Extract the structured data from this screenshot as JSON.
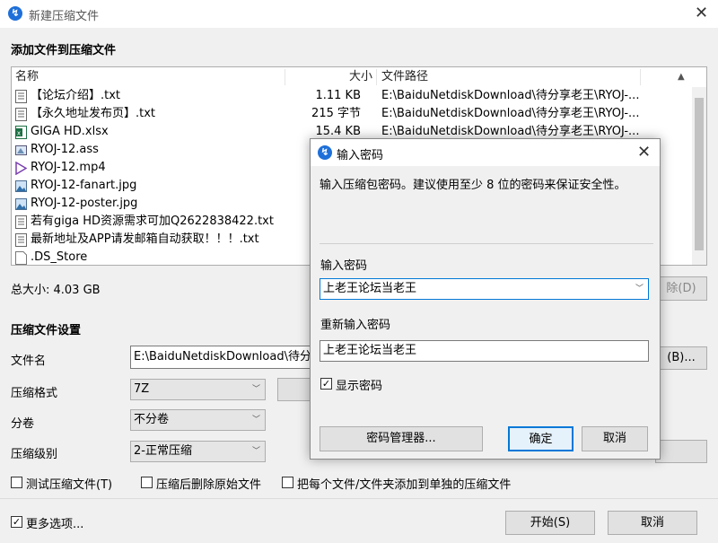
{
  "window": {
    "title": "新建压缩文件",
    "section_add": "添加文件到压缩文件",
    "list_headers": {
      "name": "名称",
      "size": "大小",
      "path": "文件路径"
    },
    "files": [
      {
        "name": "【论坛介绍】.txt",
        "size": "1.11 KB",
        "path": "E:\\BaiduNetdiskDownload\\待分享老王\\RYOJ-...",
        "icon": "text-file-icon"
      },
      {
        "name": "【永久地址发布页】.txt",
        "size": "215 字节",
        "path": "E:\\BaiduNetdiskDownload\\待分享老王\\RYOJ-...",
        "icon": "text-file-icon"
      },
      {
        "name": "GIGA HD.xlsx",
        "size": "15.4 KB",
        "path": "E:\\BaiduNetdiskDownload\\待分享老王\\RYOJ-...",
        "icon": "excel-file-icon"
      },
      {
        "name": "RYOJ-12.ass",
        "size": "",
        "path": "",
        "icon": "subtitle-file-icon"
      },
      {
        "name": "RYOJ-12.mp4",
        "size": "",
        "path": "",
        "icon": "video-file-icon"
      },
      {
        "name": "RYOJ-12-fanart.jpg",
        "size": "",
        "path": "",
        "icon": "image-file-icon"
      },
      {
        "name": "RYOJ-12-poster.jpg",
        "size": "",
        "path": "",
        "icon": "image-file-icon"
      },
      {
        "name": "若有giga HD资源需求可加Q2622838422.txt",
        "size": "",
        "path": "",
        "icon": "text-file-icon"
      },
      {
        "name": "最新地址及APP请发邮箱自动获取！！！.txt",
        "size": "",
        "path": "",
        "icon": "text-file-icon"
      },
      {
        "name": ".DS_Store",
        "size": "",
        "path": "",
        "icon": "blank-file-icon"
      }
    ],
    "total_size": "总大小: 4.03 GB",
    "delete_button_partial": "除(D)",
    "section_settings": "压缩文件设置",
    "filename_label": "文件名",
    "filename_value": "E:\\BaiduNetdiskDownload\\待分享",
    "browse_button_partial": "(B)...",
    "format_label": "压缩格式",
    "format_value": "7Z",
    "split_label": "分卷",
    "split_value": "不分卷",
    "level_label": "压缩级别",
    "level_value": "2-正常压缩",
    "opt_test": "测试压缩文件(T)",
    "opt_delete": "压缩后删除原始文件",
    "opt_separate": "把每个文件/文件夹添加到单独的压缩文件",
    "more_options": "更多选项...",
    "start_button": "开始(S)",
    "cancel_button": "取消"
  },
  "dialog": {
    "title": "输入密码",
    "info": "输入压缩包密码。建议使用至少 8 位的密码来保证安全性。",
    "password_label": "输入密码",
    "password_value": "上老王论坛当老王",
    "confirm_label": "重新输入密码",
    "confirm_value": "上老王论坛当老王",
    "show_password": "显示密码",
    "manager_button": "密码管理器...",
    "ok_button": "确定",
    "cancel_button": "取消"
  },
  "colors": {
    "accent": "#0078d7",
    "app_icon": "#1e6fd9"
  }
}
